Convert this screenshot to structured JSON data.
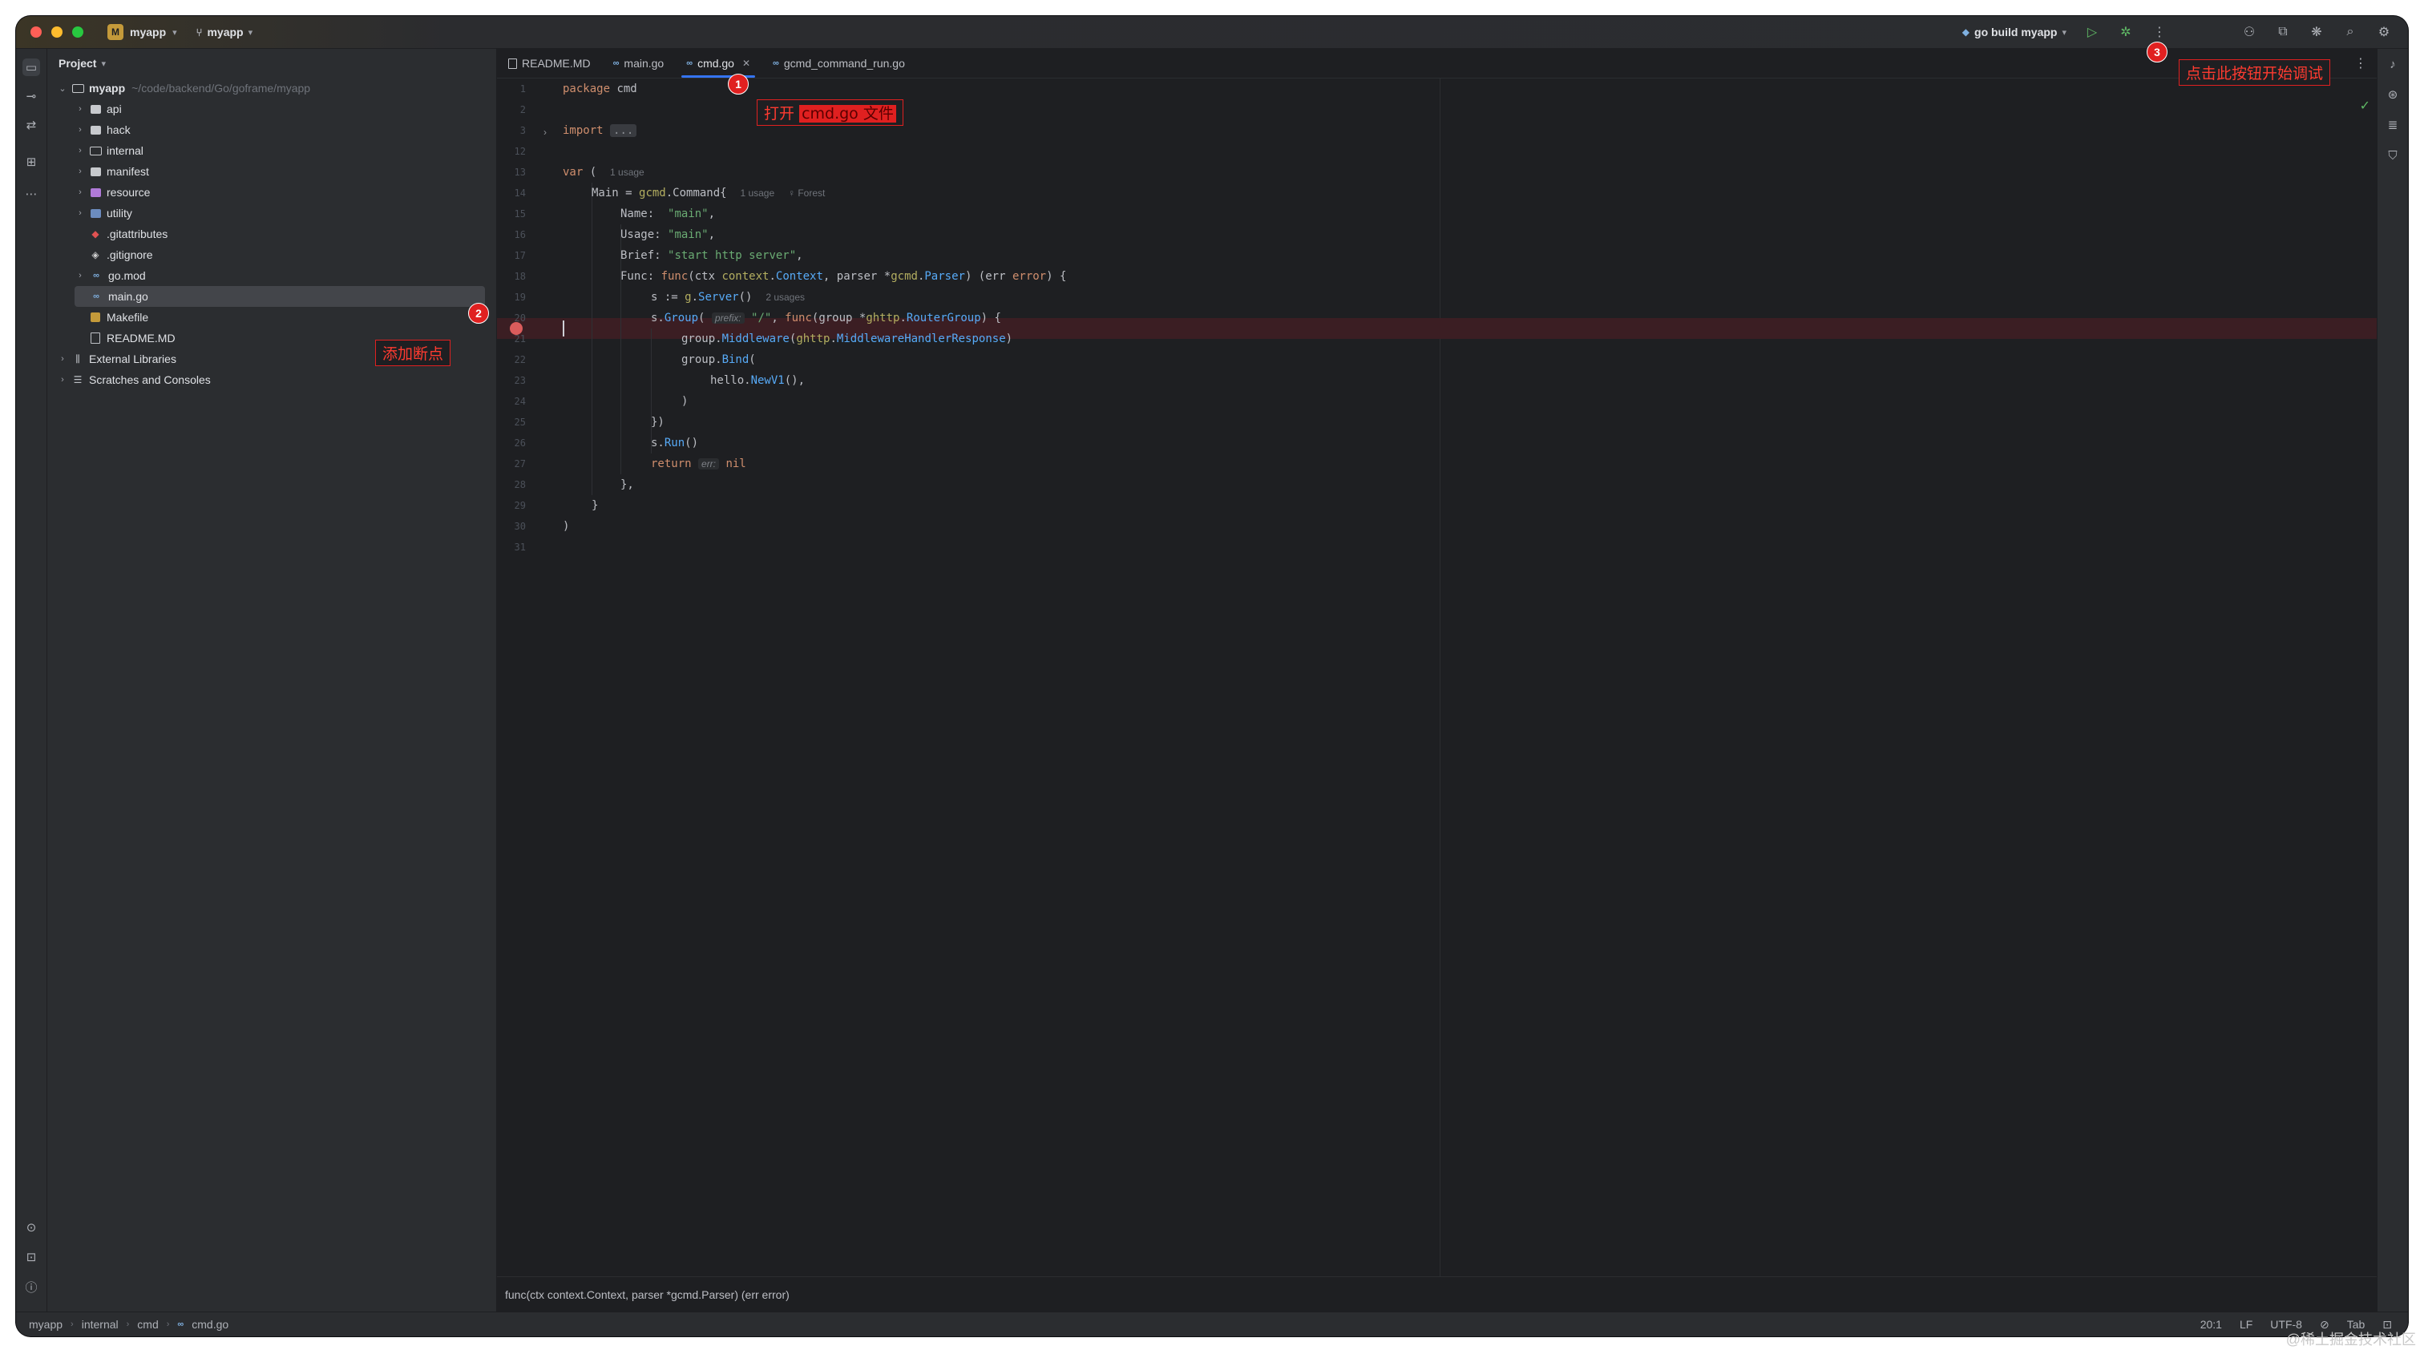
{
  "titlebar": {
    "project_badge": "M",
    "project_name": "myapp",
    "branch": "myapp",
    "run_config": "go build myapp"
  },
  "project_panel": {
    "title": "Project",
    "root": {
      "label": "myapp",
      "path": "~/code/backend/Go/goframe/myapp"
    },
    "items": [
      {
        "label": "api",
        "kind": "folder"
      },
      {
        "label": "hack",
        "kind": "folder"
      },
      {
        "label": "internal",
        "kind": "folder-open"
      },
      {
        "label": "manifest",
        "kind": "folder"
      },
      {
        "label": "resource",
        "kind": "folder-purple"
      },
      {
        "label": "utility",
        "kind": "folder-teal"
      },
      {
        "label": ".gitattributes",
        "kind": "git"
      },
      {
        "label": ".gitignore",
        "kind": "git"
      },
      {
        "label": "go.mod",
        "kind": "go"
      },
      {
        "label": "main.go",
        "kind": "go"
      },
      {
        "label": "Makefile",
        "kind": "make"
      },
      {
        "label": "README.MD",
        "kind": "doc"
      }
    ],
    "external_libraries": "External Libraries",
    "scratches": "Scratches and Consoles"
  },
  "tabs": [
    {
      "label": "README.MD",
      "icon": "doc"
    },
    {
      "label": "main.go",
      "icon": "go"
    },
    {
      "label": "cmd.go",
      "icon": "go",
      "active": true
    },
    {
      "label": "gcmd_command_run.go",
      "icon": "go"
    }
  ],
  "code": {
    "line_numbers": [
      "1",
      "2",
      "3",
      "12",
      "13",
      "14",
      "15",
      "16",
      "17",
      "18",
      "19",
      "20",
      "21",
      "22",
      "23",
      "24",
      "25",
      "26",
      "27",
      "28",
      "29",
      "30",
      "31"
    ],
    "l1_kw": "package",
    "l1_name": " cmd",
    "l3_kw": "import",
    "l3_fold": "...",
    "l13_kw": "var",
    "l13_rest": " (",
    "l13_hint": "1 usage",
    "l14_a": "Main = ",
    "l14_pkg": "gcmd",
    "l14_b": ".Command{",
    "l14_hint": "1 usage",
    "l14_author": "♀ Forest",
    "l15_a": "Name:  ",
    "l15_s": "\"main\"",
    "l15_b": ",",
    "l16_a": "Usage: ",
    "l16_s": "\"main\"",
    "l16_b": ",",
    "l17_a": "Brief: ",
    "l17_s": "\"start http server\"",
    "l17_b": ",",
    "l18_a": "Func: ",
    "l18_kw": "func",
    "l18_b": "(ctx ",
    "l18_pkg1": "context",
    "l18_c": ".",
    "l18_t1": "Context",
    "l18_d": ", parser *",
    "l18_pkg2": "gcmd",
    "l18_e": ".",
    "l18_t2": "Parser",
    "l18_f": ") (err ",
    "l18_kw2": "error",
    "l18_g": ") {",
    "l19_a": "s := ",
    "l19_pkg": "g",
    "l19_b": ".",
    "l19_fn": "Server",
    "l19_c": "()",
    "l19_hint": "2 usages",
    "l20_a": "s.",
    "l20_fn": "Group",
    "l20_b": "(",
    "l20_inlay": "prefix:",
    "l20_s": "\"/\"",
    "l20_c": ", ",
    "l20_kw": "func",
    "l20_d": "(group *",
    "l20_pkg": "ghttp",
    "l20_e": ".",
    "l20_t": "RouterGroup",
    "l20_f": ") {",
    "l21_a": "group.",
    "l21_fn": "Middleware",
    "l21_b": "(",
    "l21_pkg": "ghttp",
    "l21_c": ".",
    "l21_t": "MiddlewareHandlerResponse",
    "l21_d": ")",
    "l22_a": "group.",
    "l22_fn": "Bind",
    "l22_b": "(",
    "l23_a": "hello.",
    "l23_fn": "NewV1",
    "l23_b": "(),",
    "l24": ")",
    "l25": "})",
    "l26_a": "s.",
    "l26_fn": "Run",
    "l26_b": "()",
    "l27_kw": "return",
    "l27_inlay": "err:",
    "l27_nil": "nil",
    "l28": "},",
    "l29": "}",
    "l30": ")"
  },
  "hint_bar": "func(ctx context.Context, parser *gcmd.Parser) (err error)",
  "statusbar": {
    "crumbs": [
      "myapp",
      "internal",
      "cmd",
      "cmd.go"
    ],
    "position": "20:1",
    "line_sep": "LF",
    "encoding": "UTF-8",
    "indent": "Tab"
  },
  "annotations": {
    "n1": "1",
    "n2": "2",
    "n3": "3",
    "open_prefix": "打开",
    "open_file": "cmd.go 文件",
    "add_breakpoint": "添加断点",
    "click_debug": "点击此按钮开始调试"
  },
  "watermark": "@稀土掘金技术社区",
  "colors": {
    "accent": "#3574f0",
    "breakpoint": "#db5c5c",
    "annotation": "#e02020"
  }
}
